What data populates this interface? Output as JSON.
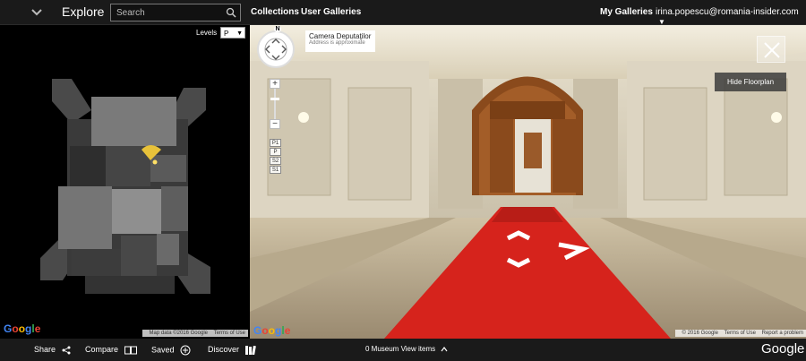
{
  "topbar": {
    "explore_label": "Explore",
    "search_placeholder": "Search",
    "collections_label": "Collections",
    "user_galleries_label": "User Galleries",
    "my_galleries_label": "My Galleries",
    "account_email": "irina.popescu@romania-insider.com"
  },
  "map": {
    "levels_label": "Levels",
    "levels_value": "P",
    "google_logo": "Google",
    "map_data": "Map data ©2016 Google",
    "terms": "Terms of Use"
  },
  "pano": {
    "compass_letter": "N",
    "zoom_in": "+",
    "zoom_out": "−",
    "floors": [
      "P1",
      "P",
      "S2",
      "S1"
    ],
    "place_title": "Camera Deputaţilor",
    "place_subtitle": "Address is approximate",
    "hide_floorplan_label": "Hide Floorplan",
    "google_logo": "Google",
    "copyright": "© 2016 Google",
    "terms": "Terms of Use",
    "report": "Report a problem"
  },
  "bottombar": {
    "share_label": "Share",
    "compare_label": "Compare",
    "saved_label": "Saved",
    "discover_label": "Discover",
    "museum_view_label": "0 Museum View items",
    "google_wordmark": "Google"
  },
  "colors": {
    "topbar_bg": "#1a1a1a",
    "carpet_red": "#d6231c",
    "door_wood": "#8a4a1c"
  }
}
